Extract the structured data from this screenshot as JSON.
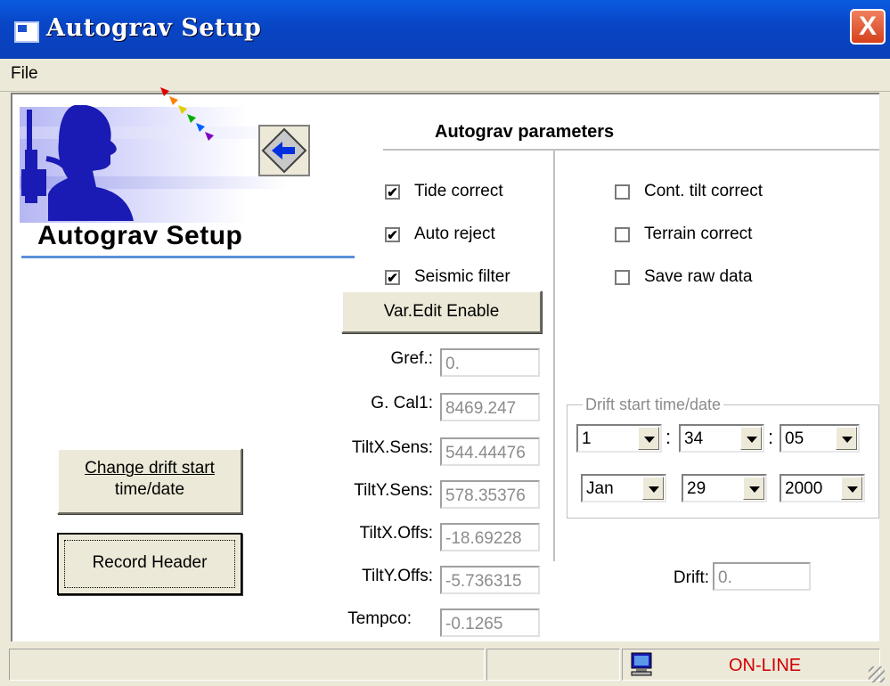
{
  "window": {
    "title": "Autograv Setup",
    "close_label": "X"
  },
  "menu": {
    "file": "File"
  },
  "logo": {
    "heading": "Autograv Setup"
  },
  "params": {
    "title": "Autograv parameters",
    "left_checks": [
      {
        "label": "Tide correct",
        "checked": true
      },
      {
        "label": "Auto reject",
        "checked": true
      },
      {
        "label": "Seismic filter",
        "checked": true
      }
    ],
    "right_checks": [
      {
        "label": "Cont. tilt correct",
        "checked": false
      },
      {
        "label": "Terrain correct",
        "checked": false
      },
      {
        "label": "Save raw data",
        "checked": false
      }
    ],
    "var_edit_button": "Var.Edit Enable",
    "fields": [
      {
        "label": "Gref.:",
        "value": "0."
      },
      {
        "label": "G. Cal1:",
        "value": "8469.247"
      },
      {
        "label": "TiltX.Sens:",
        "value": "544.44476"
      },
      {
        "label": "TiltY.Sens:",
        "value": "578.35376"
      },
      {
        "label": "TiltX.Offs:",
        "value": "-18.69228"
      },
      {
        "label": "TiltY.Offs:",
        "value": "-5.736315"
      },
      {
        "label": "Tempco:",
        "value": "-0.1265"
      }
    ]
  },
  "drift": {
    "group_title": "Drift start time/date",
    "hour": "1",
    "minute": "34",
    "second": "05",
    "month": "Jan",
    "day": "29",
    "year": "2000",
    "separator": ":",
    "drift_label": "Drift:",
    "drift_value": "0."
  },
  "buttons": {
    "change_drift_line1": "Change drift start",
    "change_drift_line2": "time/date",
    "record_header": "Record Header"
  },
  "status": {
    "connection": "ON-LINE"
  },
  "colors": {
    "titlebar": "#0846c6",
    "online": "#d00000",
    "heading_rule": "#5a8fd8"
  }
}
